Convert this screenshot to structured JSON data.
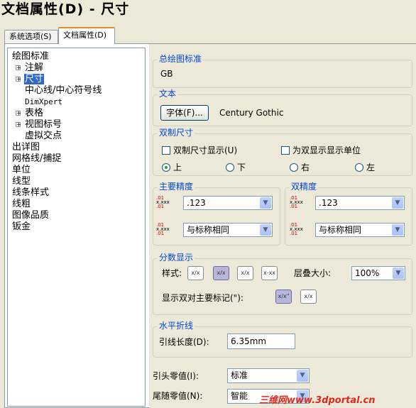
{
  "window": {
    "title": "文档属性(D) - 尺寸"
  },
  "tabs": [
    {
      "label": "系统选项(S)",
      "active": false
    },
    {
      "label": "文档属性(D)",
      "active": true
    }
  ],
  "tree": {
    "items": [
      {
        "label": "绘图标准"
      },
      {
        "label": "注解"
      },
      {
        "label": "尺寸"
      },
      {
        "label": "中心线/中心符号线"
      },
      {
        "label": "DimXpert"
      },
      {
        "label": "表格"
      },
      {
        "label": "视图标号"
      },
      {
        "label": "虚拟交点"
      },
      {
        "label": "出详图"
      },
      {
        "label": "网格线/捕捉"
      },
      {
        "label": "单位"
      },
      {
        "label": "线型"
      },
      {
        "label": "线条样式"
      },
      {
        "label": "线粗"
      },
      {
        "label": "图像品质"
      },
      {
        "label": "钣金"
      }
    ],
    "selected": "尺寸"
  },
  "standard": {
    "label": "总绘图标准",
    "value": "GB"
  },
  "text": {
    "label": "文本",
    "font_button": "字体(F)...",
    "font_name": "Century Gothic"
  },
  "dual": {
    "label": "双制尺寸",
    "show_dual": "双制尺寸显示(U)",
    "show_units": "为双显示显示单位",
    "pos_top": "上",
    "pos_bottom": "下",
    "pos_right": "右",
    "pos_left": "左",
    "selected_position": "上"
  },
  "primary_precision": {
    "label": "主要精度",
    "value": ".123",
    "tolerance": "与标称相同"
  },
  "dual_precision": {
    "label": "双精度",
    "value": ".123",
    "tolerance": "与标称相同"
  },
  "precision_icon": {
    "line1": ".01",
    "line2": "x.xxx",
    "line3": ".01"
  },
  "fraction": {
    "label": "分数显示",
    "style_label": "样式:",
    "stack_label": "层叠大小:",
    "stack_value": "100%",
    "dual_label": "显示双对主要标记(\"):",
    "styles": [
      "x/x",
      "x/x",
      "x/x",
      "x-xx"
    ],
    "dual_icon": "x/x\""
  },
  "leader": {
    "label": "水平折线",
    "length_label": "引线长度(D):",
    "length_value": "6.35mm"
  },
  "leading_zero": {
    "label": "引头零值(I):",
    "value": "标准"
  },
  "trailing_zero": {
    "label": "尾随零值(N):",
    "value": "智能"
  },
  "watermark": {
    "text": "三维网www.3dportal.cn"
  },
  "colors": {
    "accent": "#0046d5",
    "selection": "#316ac5",
    "watermark": "#e0281a"
  }
}
